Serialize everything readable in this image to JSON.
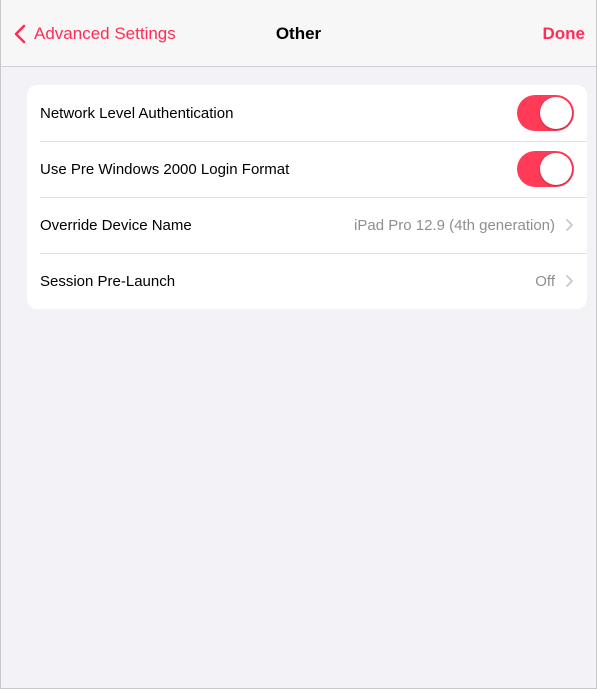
{
  "navbar": {
    "back_label": "Advanced Settings",
    "title": "Other",
    "done_label": "Done",
    "accent_color": "#ff2d55",
    "back_icon": "chevron-left-icon"
  },
  "settings": {
    "rows": [
      {
        "label": "Network Level Authentication",
        "type": "toggle",
        "on": true
      },
      {
        "label": "Use Pre Windows 2000 Login Format",
        "type": "toggle",
        "on": true
      },
      {
        "label": "Override Device Name",
        "type": "disclosure",
        "value": "iPad Pro 12.9 (4th generation)",
        "icon": "chevron-right-icon"
      },
      {
        "label": "Session Pre-Launch",
        "type": "disclosure",
        "value": "Off",
        "icon": "chevron-right-icon"
      }
    ],
    "toggle_on_color": "#ff3b57"
  }
}
